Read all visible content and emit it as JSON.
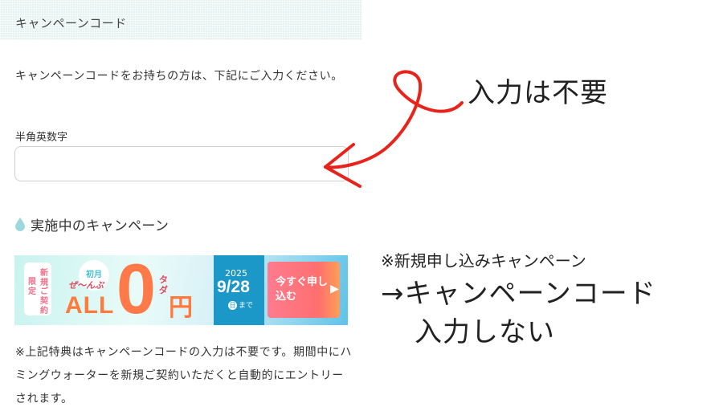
{
  "section": {
    "title": "キャンペーンコード",
    "description": "キャンペーンコードをお持ちの方は、下記にご入力ください。",
    "input_label": "半角英数字",
    "input_value": "",
    "input_placeholder": ""
  },
  "campaign": {
    "heading": "実施中のキャンペーン",
    "banner": {
      "badge_top": "新規",
      "badge_mid": "ご契約",
      "badge_left": "限定",
      "first_month": "初月",
      "zeh": "ぜ〜んぶ",
      "all": "ALL",
      "zero": "0",
      "tada": "タダ",
      "yen": "円",
      "year": "2025",
      "date": "9/28",
      "day_mark": "日",
      "until": "まで",
      "cta": "今すぐ申し込む",
      "cta_arrow": "▶"
    },
    "note": "※上記特典はキャンペーンコードの入力は不要です。期間中にハミングウォーターを新規ご契約いただくと自動的にエントリーされます。"
  },
  "annotations": {
    "no_input": "入力は不要",
    "new_application": "※新規申し込みキャンペーン",
    "arrow_code": "→キャンペーンコード",
    "dont_enter": "入力しない",
    "arrow_color": "#e8231b"
  },
  "colors": {
    "header_bg": "#e4f3f1",
    "accent_blue": "#1b98c8",
    "accent_orange": "#ff7a3c",
    "cta_pink": "#ff7b8f"
  }
}
